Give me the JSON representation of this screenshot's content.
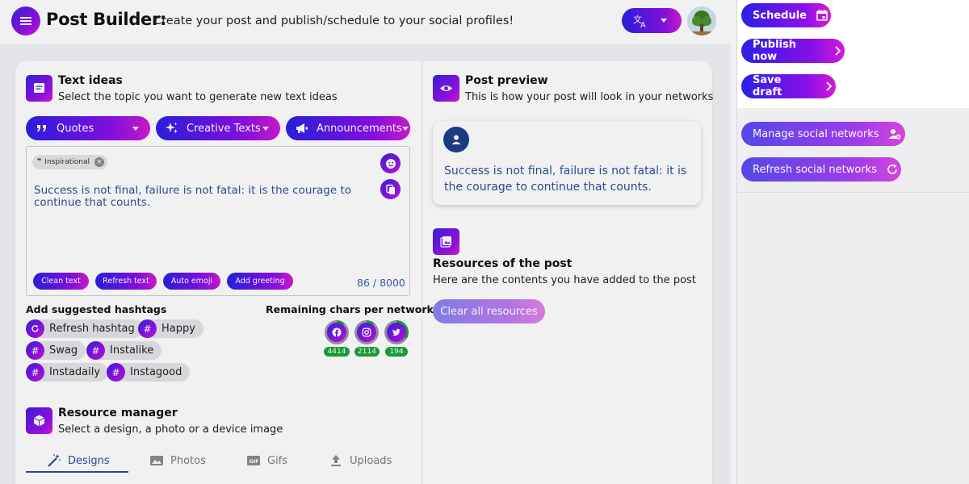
{
  "header": {
    "title": "Post Builder:",
    "subtitle": "Create your post and publish/schedule to your social profiles!",
    "menu_icon": "hamburger-icon",
    "language_icon": "translate-icon"
  },
  "text_ideas": {
    "title": "Text ideas",
    "description": "Select the topic you want to generate new text ideas",
    "topics": [
      {
        "label": "Quotes",
        "icon": "quote-icon"
      },
      {
        "label": "Creative Texts",
        "icon": "sparkle-icon"
      },
      {
        "label": "Announcements",
        "icon": "megaphone-icon"
      }
    ],
    "chip": "Inspirational",
    "text": "Success is not final, failure is not fatal: it is the courage to continue that counts.",
    "actions": [
      "Clean text",
      "Refresh text",
      "Auto emoji",
      "Add greeting"
    ],
    "counter": "86 / 8000"
  },
  "hashtags": {
    "title": "Add suggested hashtags",
    "refresh": "Refresh hashtag",
    "items": [
      "Happy",
      "Swag",
      "Instalike",
      "Instadaily",
      "Instagood"
    ]
  },
  "remaining": {
    "title": "Remaining chars per network",
    "networks": [
      {
        "name": "facebook-icon",
        "count": "4414"
      },
      {
        "name": "instagram-icon",
        "count": "2114"
      },
      {
        "name": "twitter-icon",
        "count": "194"
      }
    ]
  },
  "resource_manager": {
    "title": "Resource manager",
    "description": "Select a design, a photo or a device image",
    "tabs": [
      "Designs",
      "Photos",
      "Gifs",
      "Uploads"
    ],
    "active_tab": "Designs"
  },
  "preview": {
    "title": "Post preview",
    "description": "This is how your post will look in your networks",
    "text": "Success is not final, failure is not fatal: it is the courage to continue that counts."
  },
  "resources": {
    "title": "Resources of the post",
    "description": "Here are the contents you have added to the post",
    "clear_label": "Clear all resources"
  },
  "actions": {
    "schedule": "Schedule",
    "publish": "Publish now",
    "save": "Save draft",
    "manage": "Manage social networks",
    "refresh": "Refresh social networks"
  },
  "colors": {
    "accent_start": "#2b20e6",
    "accent_mid": "#8a10e8",
    "accent_end": "#d21bd8",
    "text_blue": "#2f4f9d",
    "count_green": "#19a33a"
  }
}
